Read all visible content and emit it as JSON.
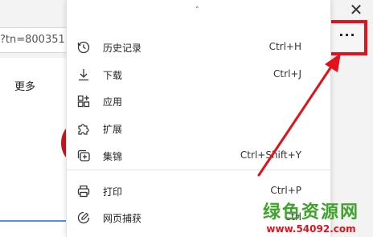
{
  "browser": {
    "address_text": "?tn=800351",
    "more_link": "更多",
    "close_glyph": "✕",
    "more_button_glyph": "···"
  },
  "menu": {
    "top_mark": "˄",
    "items": [
      {
        "label": "历史记录",
        "shortcut": "Ctrl+H",
        "icon": "history-icon"
      },
      {
        "label": "下载",
        "shortcut": "Ctrl+J",
        "icon": "download-icon"
      },
      {
        "label": "应用",
        "shortcut": "",
        "icon": "apps-icon"
      },
      {
        "label": "扩展",
        "shortcut": "",
        "icon": "extensions-icon"
      },
      {
        "label": "集锦",
        "shortcut": "Ctrl+Shift+Y",
        "icon": "collections-icon"
      },
      {
        "label": "打印",
        "shortcut": "Ctrl+P",
        "icon": "print-icon"
      },
      {
        "label": "网页捕获",
        "shortcut": "Ctrl",
        "icon": "web-capture-icon"
      }
    ]
  },
  "watermark": {
    "title": "绿色资源网",
    "url": "www.54092.com"
  },
  "colors": {
    "highlight": "#e2111b",
    "watermark_green": "#3fa52a"
  }
}
